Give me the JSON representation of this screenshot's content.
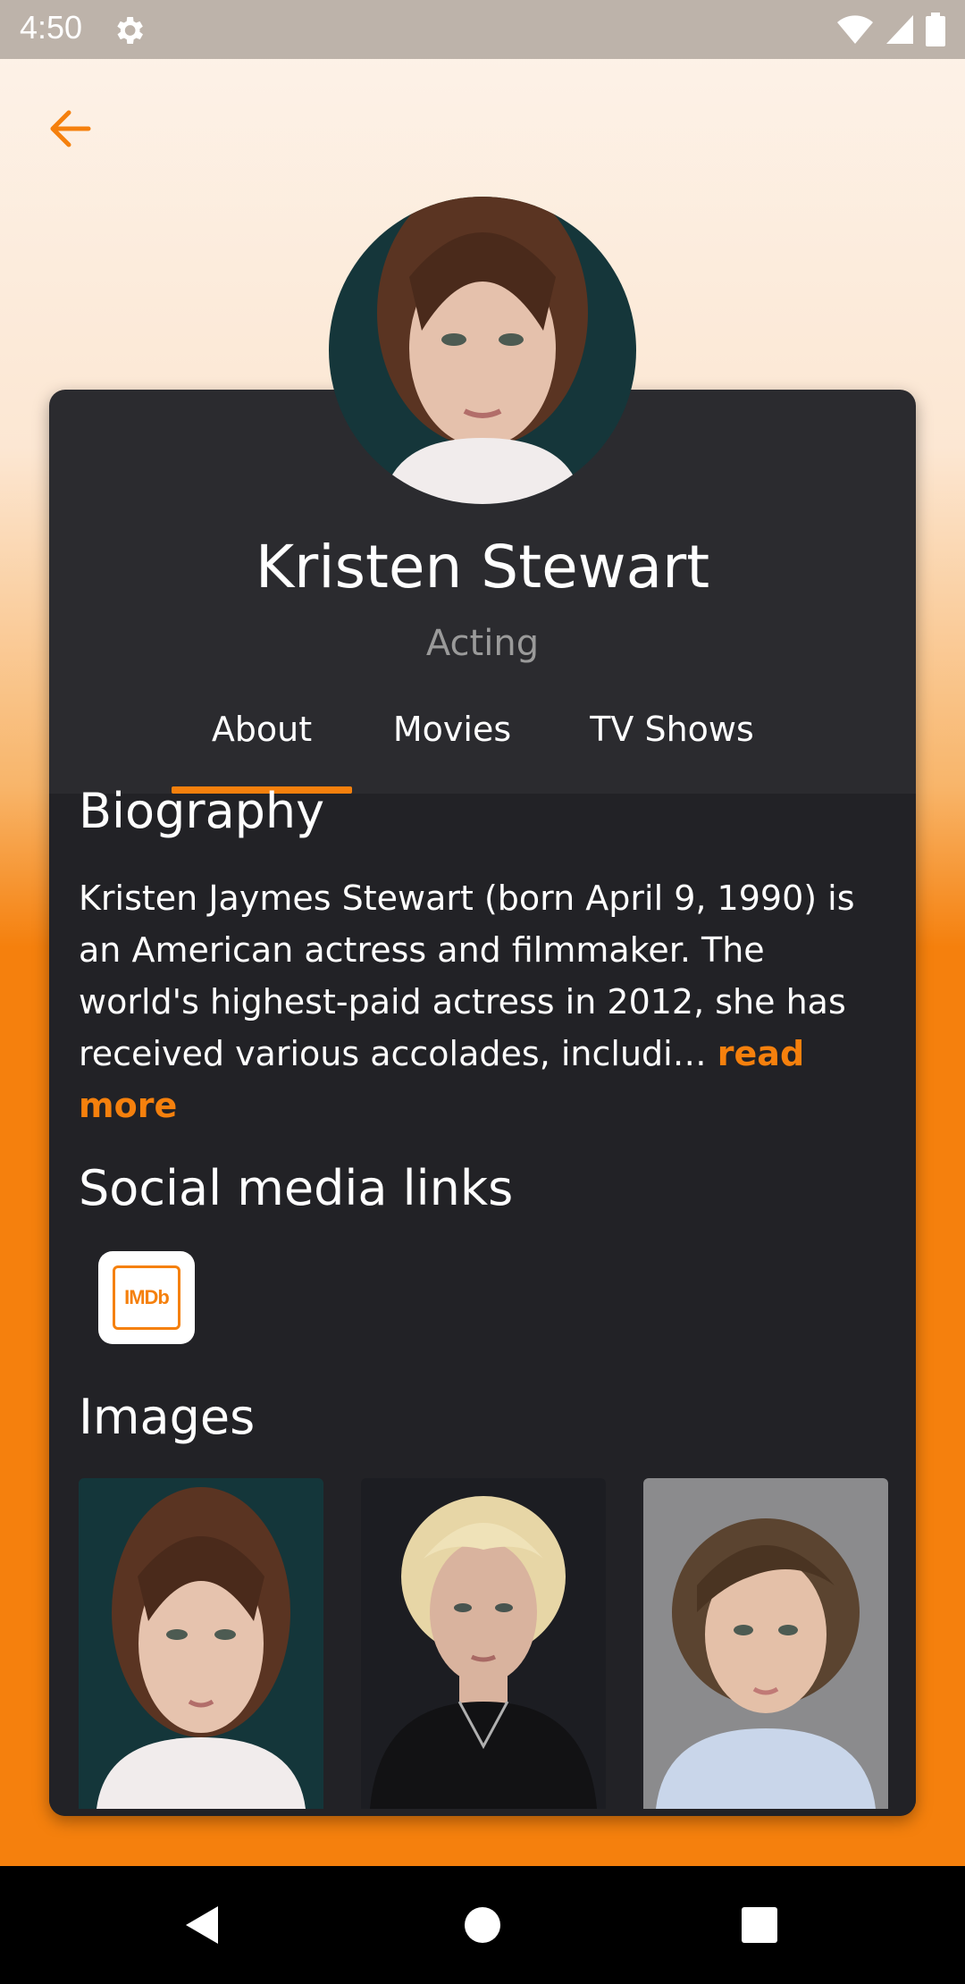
{
  "status_bar": {
    "time": "4:50"
  },
  "person": {
    "name": "Kristen Stewart",
    "department": "Acting"
  },
  "tabs": [
    {
      "label": "About",
      "selected": true
    },
    {
      "label": "Movies",
      "selected": false
    },
    {
      "label": "TV Shows",
      "selected": false
    }
  ],
  "biography": {
    "title": "Biography",
    "text": "Kristen Jaymes Stewart (born April 9, 1990) is an American actress and filmmaker. The world's highest-paid actress in 2012, she has received various accolades, includi… ",
    "read_more": "read more"
  },
  "social": {
    "title": "Social media links",
    "imdb_label": "IMDb"
  },
  "images": {
    "title": "Images"
  },
  "colors": {
    "accent": "#f5800d",
    "card": "#2b2b2f",
    "card_body": "#222226"
  }
}
